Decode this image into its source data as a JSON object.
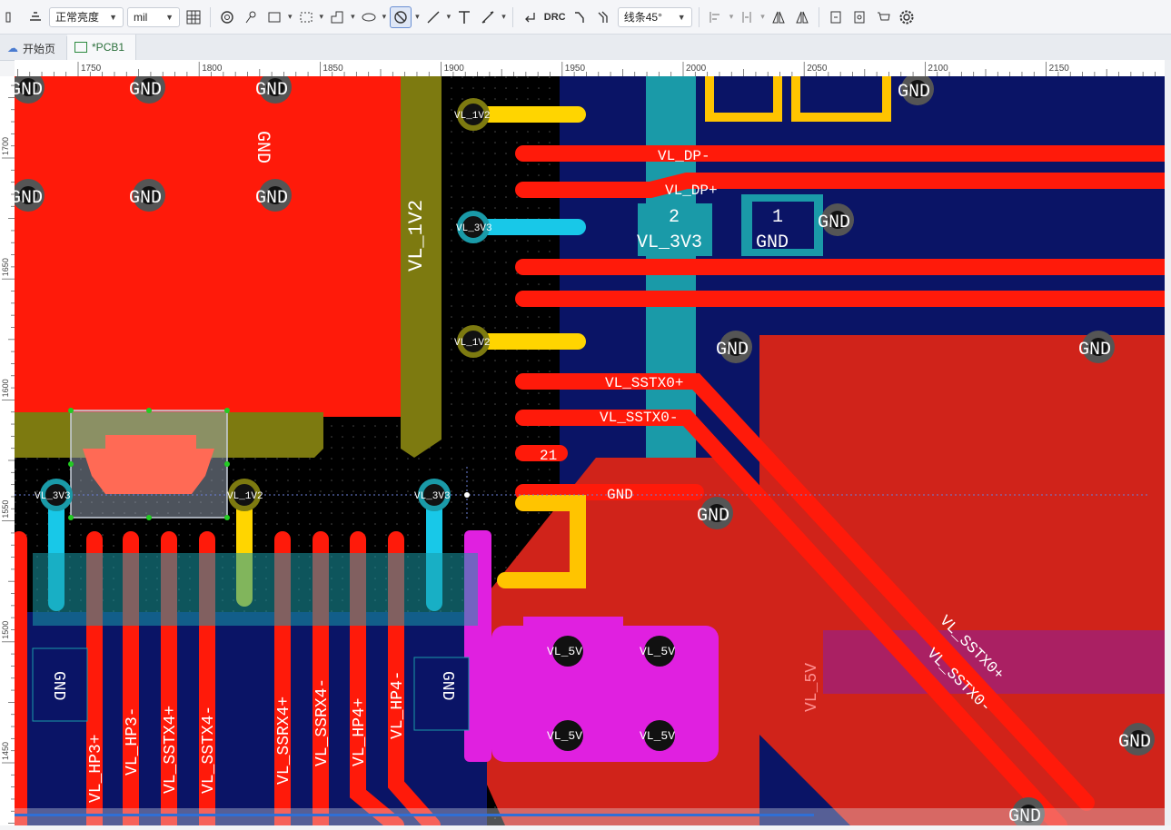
{
  "toolbar": {
    "brightness": "正常亮度",
    "unit": "mil",
    "drc": "DRC",
    "route_angle": "线条45°"
  },
  "tabs": [
    {
      "label": "开始页"
    },
    {
      "label": "*PCB1"
    }
  ],
  "ruler": {
    "top": [
      "1750",
      "1800",
      "1850",
      "1900",
      "1950",
      "2000",
      "2050",
      "2100",
      "2150"
    ],
    "left": [
      "1700",
      "1650",
      "1600",
      "1550",
      "1500",
      "1450"
    ]
  },
  "nets": {
    "gnd": "GND",
    "vl_1v2": "VL_1V2",
    "vl_3v3": "VL_3V3",
    "vl_5v": "VL_5V",
    "vl_dp_minus": "VL_DP-",
    "vl_dp_plus": "VL_DP+",
    "vl_ssrx0_plus": "VL_SSRX0+",
    "vl_ssrx0": "VL_SSRX0",
    "vl_sstx0_plus": "VL_SSTX0+",
    "vl_sstx0_minus": "VL_SSTX0-",
    "vl_hp3_plus": "VL_HP3+",
    "vl_hp3_minus": "VL_HP3-",
    "vl_sstx4_plus": "VL_SSTX4+",
    "vl_sstx4_minus": "VL_SSTX4-",
    "vl_ssrx4_plus": "VL_SSRX4+",
    "vl_ssrx4_minus": "VL_SSRX4-",
    "vl_hp4_plus": "VL_HP4+",
    "vl_hp4_minus": "VL_HP4-"
  },
  "pads": {
    "num1": "1",
    "num2": "2",
    "num21": "21"
  },
  "colors": {
    "board": "#000000",
    "top_copper": "#ff1a0a",
    "bottom_copper": "#0a1466",
    "silkscreen_yellow": "#ffd500",
    "via_ring": "#6b6b6b",
    "pad_cyan": "#18c8e8",
    "pad_magenta": "#e020e0",
    "olive_pour": "#8a8a10",
    "teal_pad": "#1a9aa8",
    "green_silk": "#3a8a2a"
  }
}
